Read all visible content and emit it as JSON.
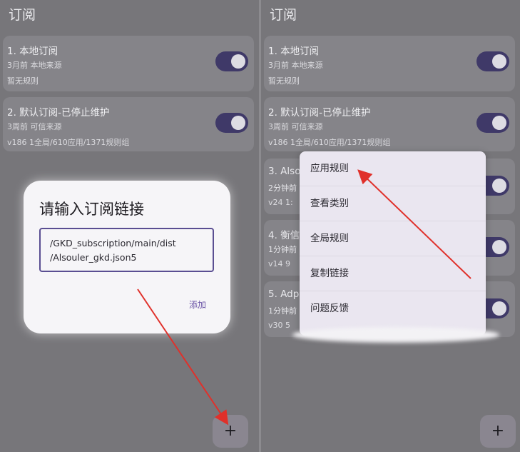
{
  "left": {
    "page_title": "订阅",
    "cards": [
      {
        "title": "1. 本地订阅",
        "meta": "3月前   本地来源",
        "extra": "暂无规则"
      },
      {
        "title": "2. 默认订阅-已停止维护",
        "meta": "3周前   可信来源",
        "extra": "v186   1全局/610应用/1371规则组"
      }
    ],
    "dialog": {
      "title": "请输入订阅链接",
      "input_line1": "/GKD_subscription/main/dist",
      "input_line2": "/Alsouler_gkd.json5",
      "add_label": "添加"
    },
    "fab_label": "+"
  },
  "right": {
    "page_title": "订阅",
    "cards": [
      {
        "title": "1. 本地订阅",
        "meta": "3月前   本地来源",
        "extra": "暂无规则"
      },
      {
        "title": "2. 默认订阅-已停止维护",
        "meta": "3周前   可信来源",
        "extra": "v186   1全局/610应用/1371规则组"
      },
      {
        "title": "3. Also",
        "meta": "2分钟前",
        "extra": "v24  1:"
      },
      {
        "title": "4. 衡信",
        "meta": "1分钟前",
        "extra": "v14  9"
      },
      {
        "title": "5. Adp",
        "meta": "1分钟前",
        "extra": "v30  5"
      }
    ],
    "menu": [
      "应用规则",
      "查看类别",
      "全局规则",
      "复制链接",
      "问题反馈"
    ],
    "fab_label": "+"
  },
  "colors": {
    "background": "#77767a",
    "card": "#858489",
    "toggle_on": "#3f3968",
    "dialog": "#f6f5f8",
    "accent": "#6750a4",
    "arrow": "#e0302a"
  },
  "icons": [
    "plus-icon",
    "toggle-switch"
  ]
}
